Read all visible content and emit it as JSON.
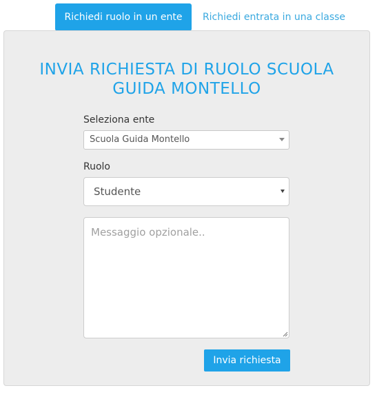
{
  "tabs": {
    "active_label": "Richiedi ruolo in un ente",
    "inactive_label": "Richiedi entrata in una classe"
  },
  "form": {
    "title_line1": "INVIA RICHIESTA DI RUOLO SCUOLA",
    "title_line2": "GUIDA MONTELLO",
    "ente_label": "Seleziona ente",
    "ente_value": "Scuola Guida Montello",
    "ruolo_label": "Ruolo",
    "ruolo_value": "Studente",
    "message_placeholder": "Messaggio opzionale..",
    "submit_label": "Invia richiesta"
  },
  "colors": {
    "accent": "#1fa3e8",
    "panel_bg": "#ededed"
  }
}
